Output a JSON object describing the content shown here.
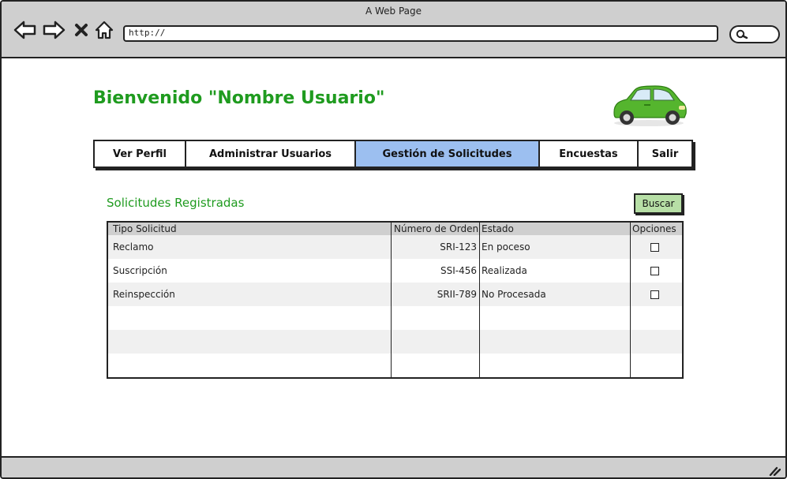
{
  "window": {
    "title": "A Web Page",
    "url": "http://"
  },
  "icons": {
    "back": "arrow-left-icon",
    "forward": "arrow-right-icon",
    "stop": "close-icon",
    "home": "home-icon",
    "search": "search-icon",
    "car": "car-logo-icon",
    "resize": "resize-grip-icon"
  },
  "colors": {
    "accent_green": "#1f9b1f",
    "active_tab": "#9cbff0",
    "button_green": "#b7dfa6",
    "chrome": "#cfcfcf"
  },
  "welcome": "Bienvenido \"Nombre Usuario\"",
  "menu": [
    {
      "label": "Ver Perfil",
      "active": false
    },
    {
      "label": "Administrar Usuarios",
      "active": false
    },
    {
      "label": "Gestión de Solicitudes",
      "active": true
    },
    {
      "label": "Encuestas",
      "active": false
    },
    {
      "label": "Salir",
      "active": false
    }
  ],
  "section_title": "Solicitudes Registradas",
  "search_button": "Buscar",
  "table": {
    "headers": [
      "Tipo Solicitud",
      "Número de Orden",
      "Estado",
      "Opciones"
    ],
    "rows": [
      {
        "tipo": "Reclamo",
        "numero": "SRI-123",
        "estado": "En poceso",
        "checked": false
      },
      {
        "tipo": "Suscripción",
        "numero": "SSI-456",
        "estado": "Realizada",
        "checked": false
      },
      {
        "tipo": "Reinspección",
        "numero": "SRII-789",
        "estado": "No Procesada",
        "checked": false
      }
    ]
  }
}
